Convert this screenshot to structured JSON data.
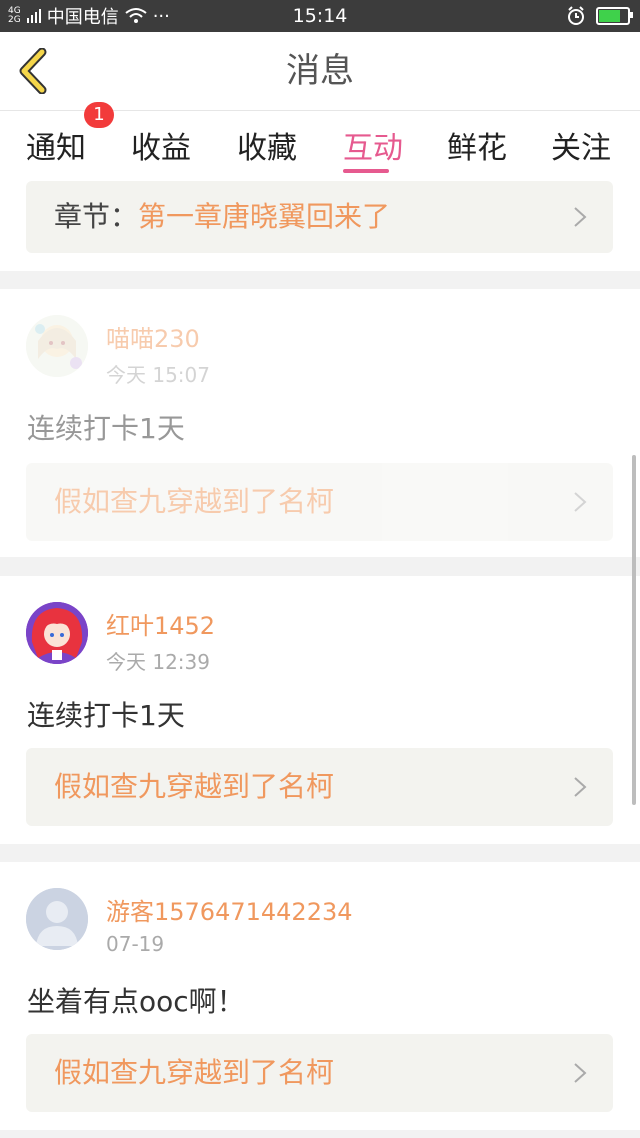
{
  "status_bar": {
    "network_top": "4G",
    "network_bottom": "2G",
    "carrier": "中国电信",
    "more": "···",
    "time": "15:14",
    "battery_level": 0.8,
    "battery_color": "#3fd14b"
  },
  "header": {
    "title": "消息"
  },
  "tabs": [
    {
      "label": "通知",
      "badge": "1"
    },
    {
      "label": "收益"
    },
    {
      "label": "收藏"
    },
    {
      "label": "互动",
      "active": true
    },
    {
      "label": "鲜花"
    },
    {
      "label": "关注"
    }
  ],
  "accent_color": "#e65a8f",
  "top_chapter": {
    "prefix": "章节：",
    "title": "第一章唐晓翼回来了"
  },
  "messages": [
    {
      "username": "喵喵230",
      "time": "今天 15:07",
      "comment": "连续打卡1天",
      "link": "假如查九穿越到了名柯",
      "avatar": "anime-girl-avatar"
    },
    {
      "username": "红叶1452",
      "time": "今天 12:39",
      "comment": "连续打卡1天",
      "link": "假如查九穿越到了名柯",
      "avatar": "red-hair-avatar"
    },
    {
      "username": "游客1576471442234",
      "time": "07-19",
      "comment": "坐着有点ooc啊！",
      "link": "假如查九穿越到了名柯",
      "avatar": "default-user-avatar"
    }
  ]
}
